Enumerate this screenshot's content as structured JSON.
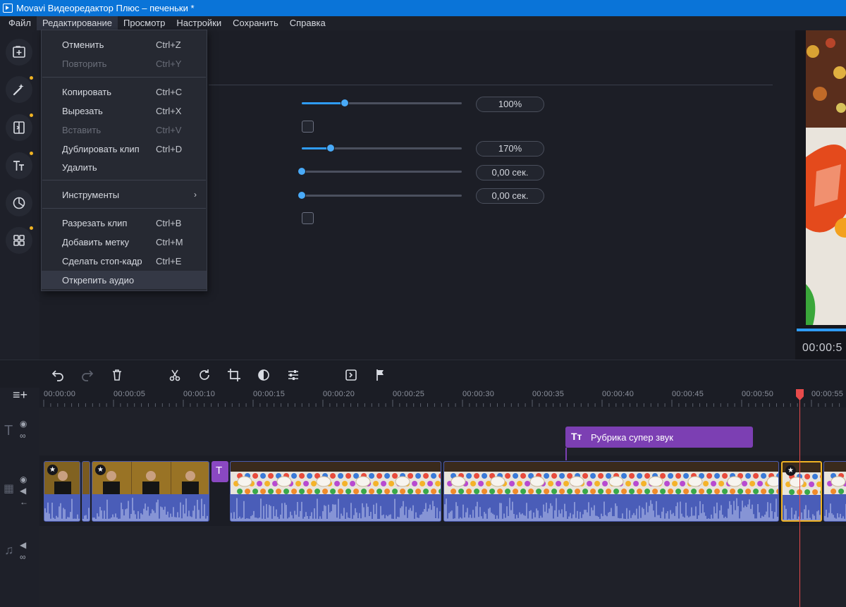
{
  "window": {
    "title": "Movavi Видеоредактор Плюс – печеньки *"
  },
  "menubar": {
    "items": [
      {
        "label": "Файл"
      },
      {
        "label": "Редактирование"
      },
      {
        "label": "Просмотр"
      },
      {
        "label": "Настройки"
      },
      {
        "label": "Сохранить"
      },
      {
        "label": "Справка"
      }
    ]
  },
  "sidebar": {
    "buttons": [
      {
        "icon": "add-media-icon"
      },
      {
        "icon": "magic-wand-icon"
      },
      {
        "icon": "transitions-icon"
      },
      {
        "icon": "titles-icon"
      },
      {
        "icon": "filters-icon"
      },
      {
        "icon": "more-tools-icon"
      }
    ],
    "dot_color": "#f0b323"
  },
  "settings": {
    "value_1": "100%",
    "value_1_fraction": 0.27,
    "value_2": "170%",
    "value_2_fraction": 0.18,
    "value_3": "0,00 сек.",
    "value_3_fraction": 0.0,
    "value_4": "0,00 сек.",
    "value_4_fraction": 0.0
  },
  "dropdown": {
    "undo": {
      "label": "Отменить",
      "shortcut": "Ctrl+Z"
    },
    "redo": {
      "label": "Повторить",
      "shortcut": "Ctrl+Y"
    },
    "copy": {
      "label": "Копировать",
      "shortcut": "Ctrl+C"
    },
    "cut": {
      "label": "Вырезать",
      "shortcut": "Ctrl+X"
    },
    "paste": {
      "label": "Вставить",
      "shortcut": "Ctrl+V"
    },
    "duplicate": {
      "label": "Дублировать клип",
      "shortcut": "Ctrl+D"
    },
    "delete": {
      "label": "Удалить"
    },
    "tools": {
      "label": "Инструменты"
    },
    "split": {
      "label": "Разрезать клип",
      "shortcut": "Ctrl+B"
    },
    "marker": {
      "label": "Добавить метку",
      "shortcut": "Ctrl+M"
    },
    "freeze": {
      "label": "Сделать стоп-кадр",
      "shortcut": "Ctrl+E"
    },
    "detach_audio": {
      "label": "Открепить аудио"
    }
  },
  "preview": {
    "timecode": "00:00:5"
  },
  "timeline": {
    "ruler": [
      "00:00:00",
      "00:00:05",
      "00:00:10",
      "00:00:15",
      "00:00:20",
      "00:00:25",
      "00:00:30",
      "00:00:35",
      "00:00:40",
      "00:00:45",
      "00:00:50",
      "00:00:55"
    ],
    "title_clip": {
      "label": "Рубрика супер звук"
    },
    "playhead_color": "#e84b4b",
    "accent": "#2f9cf5"
  }
}
